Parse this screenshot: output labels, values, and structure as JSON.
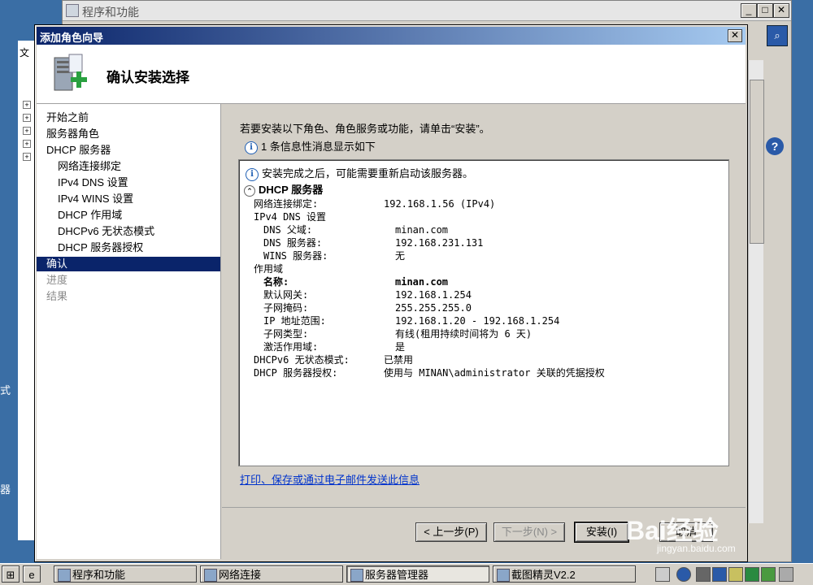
{
  "desktop": {
    "left_label_1": "式",
    "left_label_2": "器"
  },
  "bg_window": {
    "title": "程序和功能",
    "menu_fragment": "文"
  },
  "dialog": {
    "title": "添加角色向导",
    "heading": "确认安装选择",
    "nav": [
      {
        "label": "开始之前"
      },
      {
        "label": "服务器角色"
      },
      {
        "label": "DHCP 服务器"
      },
      {
        "label": "网络连接绑定"
      },
      {
        "label": "IPv4 DNS 设置"
      },
      {
        "label": "IPv4 WINS 设置"
      },
      {
        "label": "DHCP 作用域"
      },
      {
        "label": "DHCPv6 无状态模式"
      },
      {
        "label": "DHCP 服务器授权"
      },
      {
        "label": "确认"
      },
      {
        "label": "进度"
      },
      {
        "label": "结果"
      }
    ],
    "intro": "若要安装以下角色、角色服务或功能，请单击“安装”。",
    "info_message": "1 条信息性消息显示如下",
    "detail": {
      "note": "安装完成之后，可能需要重新启动该服务器。",
      "section": "DHCP 服务器",
      "rows": [
        {
          "label": "网络连接绑定:",
          "value": "192.168.1.56 (IPv4)"
        },
        {
          "label": "IPv4 DNS 设置",
          "value": ""
        },
        {
          "label": "DNS 父域:",
          "value": "minan.com"
        },
        {
          "label": "DNS 服务器:",
          "value": "192.168.231.131"
        },
        {
          "label": "WINS 服务器:",
          "value": "无"
        },
        {
          "label": "作用域",
          "value": ""
        },
        {
          "label": "名称:",
          "value": "minan.com"
        },
        {
          "label": "默认网关:",
          "value": "192.168.1.254"
        },
        {
          "label": "子网掩码:",
          "value": "255.255.255.0"
        },
        {
          "label": "IP 地址范围:",
          "value": "192.168.1.20 - 192.168.1.254"
        },
        {
          "label": "子网类型:",
          "value": "有线(租用持续时间将为 6 天)"
        },
        {
          "label": "激活作用域:",
          "value": "是"
        },
        {
          "label": "DHCPv6 无状态模式:",
          "value": "已禁用"
        },
        {
          "label": "DHCP 服务器授权:",
          "value": "使用与 MINAN\\administrator 关联的凭据授权"
        }
      ]
    },
    "link": "打印、保存或通过电子邮件发送此信息",
    "buttons": {
      "prev": "< 上一步(P)",
      "next": "下一步(N) >",
      "install": "安装(I)",
      "cancel": "取消"
    }
  },
  "taskbar": {
    "items": [
      {
        "label": "程序和功能"
      },
      {
        "label": "网络连接"
      },
      {
        "label": "服务器管理器"
      },
      {
        "label": "截图精灵V2.2"
      }
    ]
  },
  "watermark": {
    "brand": "Bai经验",
    "url": "jingyan.baidu.com"
  },
  "colors": {
    "selection": "#0a246a",
    "titlebar_start": "#0a246a",
    "titlebar_end": "#a6caf0",
    "link": "#0033cc"
  }
}
